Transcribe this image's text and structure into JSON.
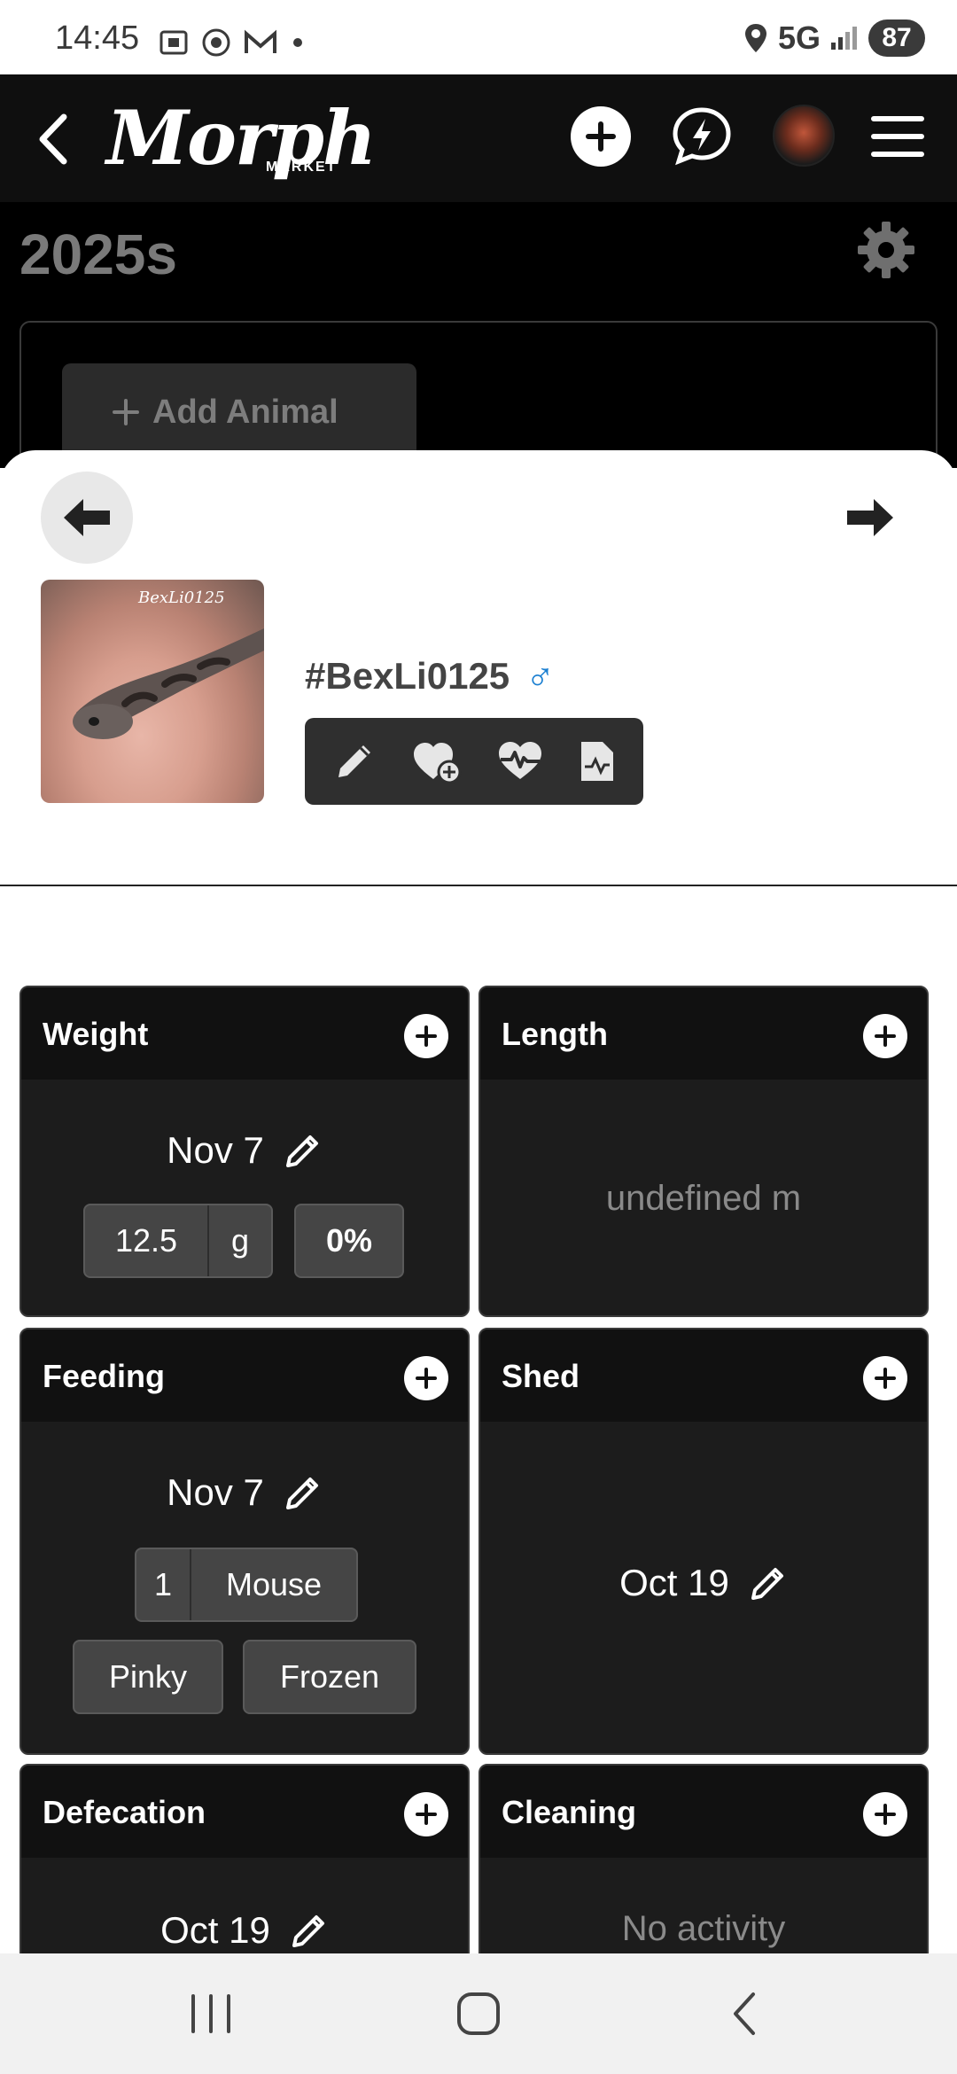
{
  "status_bar": {
    "time": "14:45",
    "network": "5G",
    "battery": "87"
  },
  "header": {
    "logo": "Morph",
    "logo_sub": "MARKET"
  },
  "page": {
    "title": "2025s",
    "add_animal_label": "Add Animal"
  },
  "animal": {
    "photo_tag": "BexLi0125",
    "id": "#BexLi0125",
    "sex_symbol": "♂"
  },
  "cards": {
    "weight": {
      "title": "Weight",
      "date": "Nov 7",
      "value": "12.5",
      "unit": "g",
      "change": "0%"
    },
    "length": {
      "title": "Length",
      "value": "undefined m"
    },
    "feeding": {
      "title": "Feeding",
      "date": "Nov 7",
      "count": "1",
      "prey": "Mouse",
      "size": "Pinky",
      "state": "Frozen"
    },
    "shed": {
      "title": "Shed",
      "date": "Oct 19"
    },
    "defecation": {
      "title": "Defecation",
      "date": "Oct 19"
    },
    "cleaning": {
      "title": "Cleaning",
      "value": "No activity"
    }
  },
  "colors": {
    "accent_male": "#1a7fd1",
    "card_bg": "#1c1c1c",
    "header_bg": "#0f0f0f"
  }
}
